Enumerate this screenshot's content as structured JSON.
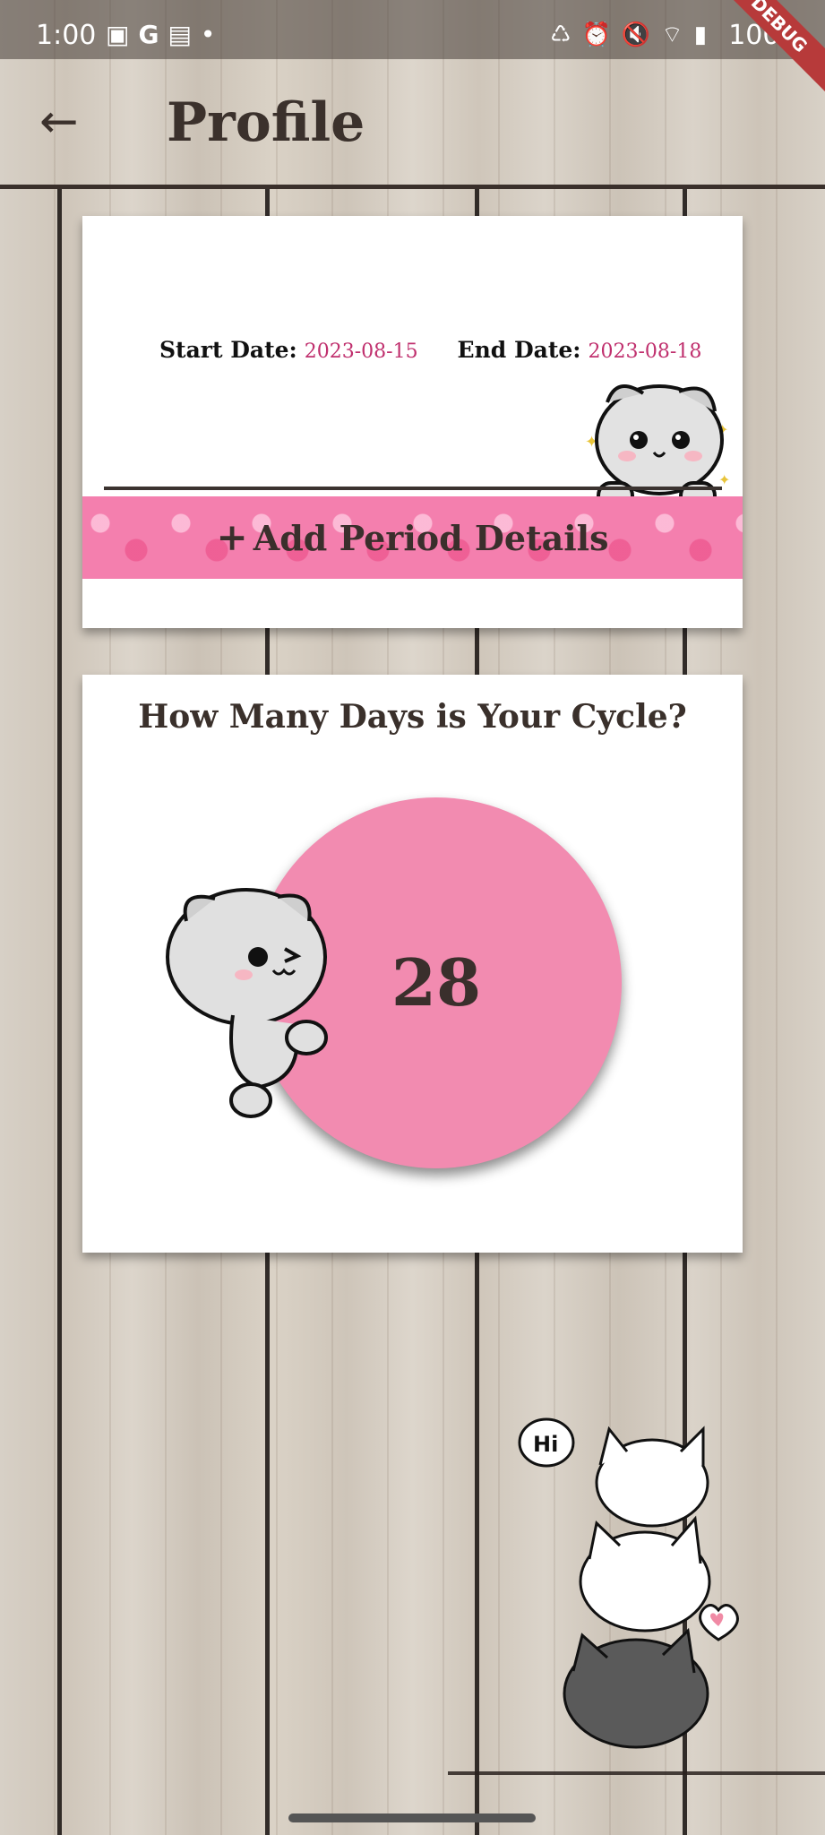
{
  "status_bar": {
    "time": "1:00",
    "left_icons": [
      "image-icon",
      "google-icon",
      "news-icon",
      "dot-icon"
    ],
    "right_icons": [
      "recycle-icon",
      "alarm-icon",
      "mute-icon",
      "wifi-icon",
      "signal-icon"
    ],
    "battery": "100%",
    "debug_label": "DEBUG"
  },
  "app_bar": {
    "back_icon": "arrow-left-icon",
    "title": "Profile"
  },
  "period_card": {
    "start_label": "Start Date:",
    "start_value": "2023-08-15",
    "end_label": "End Date:",
    "end_value": "2023-08-18",
    "add_button_label": "Add Period Details",
    "add_icon": "plus-icon",
    "banner_color": "#f47fae",
    "date_color": "#c0306e"
  },
  "cycle_card": {
    "title": "How Many Days is Your Cycle?",
    "value": "28",
    "circle_color": "#f28bb0"
  },
  "decorations": {
    "hi_bubble": "Hi"
  }
}
